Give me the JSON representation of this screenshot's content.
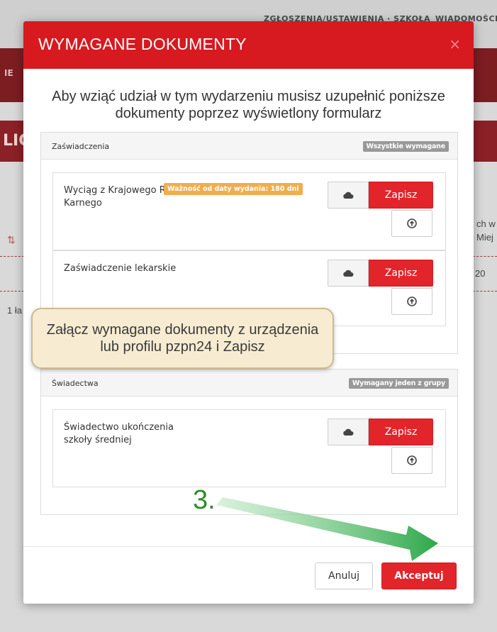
{
  "background": {
    "topbar_left": "ZGŁOSZENIA/USTAWIENIA · SZKOŁA",
    "topbar_right": "WIADOMOŚCI",
    "band_left": "IE",
    "band2_left": "LIC",
    "right_col_1": "ch w",
    "right_col_2": "Miej",
    "right_col_3": "20",
    "left_text": "1 ła"
  },
  "modal": {
    "title": "WYMAGANE DOKUMENTY",
    "close": "×",
    "intro": "Aby wziąć udział w tym wydarzeniu musisz uzupełnić poniższe dokumenty poprzez wyświetlony formularz",
    "sections": [
      {
        "title": "Zaświadczenia",
        "badge": "Wszystkie wymagane",
        "documents": [
          {
            "name": "Wyciąg z Krajowego Rejestru Karnego",
            "validity": "Ważność od daty wydania: 180 dni",
            "save": "Zapisz"
          },
          {
            "name": "Zaświadczenie lekarskie",
            "save": "Zapisz"
          }
        ]
      },
      {
        "title": "Świadectwa",
        "badge": "Wymagany jeden z grupy",
        "documents": [
          {
            "name": "Świadectwo ukończenia szkoły średniej",
            "save": "Zapisz"
          }
        ]
      }
    ],
    "footer": {
      "cancel": "Anuluj",
      "accept": "Akceptuj"
    }
  },
  "tutorial": {
    "callout": "Załącz wymagane dokumenty z urządzenia lub profilu pzpn24 i Zapisz",
    "step": "3.",
    "arrow_color": "#2ea84a"
  },
  "colors": {
    "primary_red": "#d71920",
    "button_red": "#e2242b",
    "validity_orange": "#f0ad4e",
    "badge_grey": "#999999"
  }
}
